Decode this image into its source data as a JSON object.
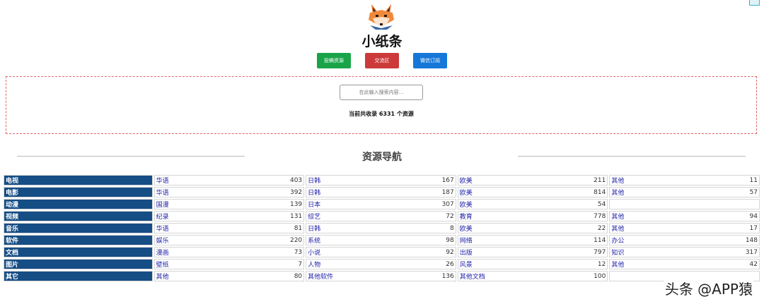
{
  "site": {
    "title": "小纸条"
  },
  "buttons": [
    {
      "label": "投稿资源",
      "color": "#1aa44a"
    },
    {
      "label": "交流区",
      "color": "#cc3a3a"
    },
    {
      "label": "微信订阅",
      "color": "#1577d8"
    }
  ],
  "search": {
    "placeholder": "在此输入搜索内容...",
    "count_text": "当前共收录 6331 个资源"
  },
  "nav": {
    "title": "资源导航",
    "rows": [
      {
        "category": "电视",
        "items": [
          {
            "name": "华语",
            "count": "403"
          },
          {
            "name": "日韩",
            "count": "167"
          },
          {
            "name": "欧美",
            "count": "211"
          },
          {
            "name": "其他",
            "count": "11"
          }
        ]
      },
      {
        "category": "电影",
        "items": [
          {
            "name": "华语",
            "count": "392"
          },
          {
            "name": "日韩",
            "count": "187"
          },
          {
            "name": "欧美",
            "count": "814"
          },
          {
            "name": "其他",
            "count": "57"
          }
        ]
      },
      {
        "category": "动漫",
        "items": [
          {
            "name": "国漫",
            "count": "139"
          },
          {
            "name": "日本",
            "count": "307"
          },
          {
            "name": "欧美",
            "count": "54"
          },
          {
            "name": "",
            "count": ""
          }
        ]
      },
      {
        "category": "视频",
        "items": [
          {
            "name": "纪录",
            "count": "131"
          },
          {
            "name": "综艺",
            "count": "72"
          },
          {
            "name": "教育",
            "count": "778"
          },
          {
            "name": "其他",
            "count": "94"
          }
        ]
      },
      {
        "category": "音乐",
        "items": [
          {
            "name": "华语",
            "count": "81"
          },
          {
            "name": "日韩",
            "count": "8"
          },
          {
            "name": "欧美",
            "count": "22"
          },
          {
            "name": "其他",
            "count": "17"
          }
        ]
      },
      {
        "category": "软件",
        "items": [
          {
            "name": "娱乐",
            "count": "220"
          },
          {
            "name": "系统",
            "count": "98"
          },
          {
            "name": "网络",
            "count": "114"
          },
          {
            "name": "办公",
            "count": "148"
          }
        ]
      },
      {
        "category": "文档",
        "items": [
          {
            "name": "漫画",
            "count": "73"
          },
          {
            "name": "小说",
            "count": "92"
          },
          {
            "name": "出版",
            "count": "797"
          },
          {
            "name": "知识",
            "count": "317"
          }
        ]
      },
      {
        "category": "图片",
        "items": [
          {
            "name": "壁纸",
            "count": "7"
          },
          {
            "name": "人物",
            "count": "26"
          },
          {
            "name": "风景",
            "count": "12"
          },
          {
            "name": "其他",
            "count": "42"
          }
        ]
      },
      {
        "category": "其它",
        "items": [
          {
            "name": "其他",
            "count": "80"
          },
          {
            "name": "其他软件",
            "count": "136"
          },
          {
            "name": "其他文档",
            "count": "100"
          },
          {
            "name": "",
            "count": ""
          }
        ]
      }
    ]
  },
  "watermark": "头条 @APP猿",
  "colors": {
    "category_bg": "#154d85",
    "link": "#2222aa",
    "search_border": "#e06666"
  }
}
